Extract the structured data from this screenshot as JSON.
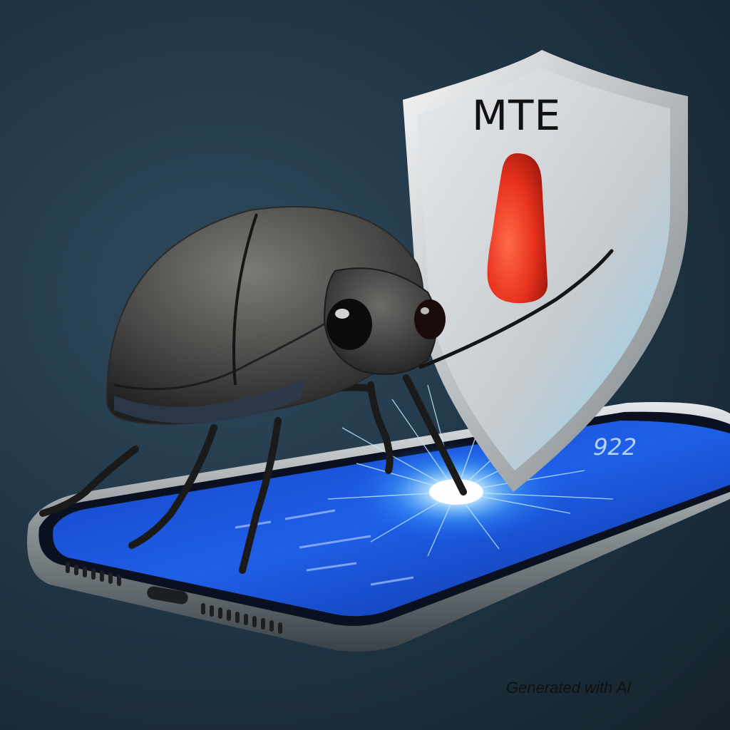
{
  "shield": {
    "label": "MTE"
  },
  "phone": {
    "clock": "922"
  },
  "caption": "Generated with AI",
  "colors": {
    "background": "#1c2f3d",
    "shield_silver": "#c9ced2",
    "drop_red": "#e8321e",
    "screen_blue": "#1a4fd8",
    "spark": "#bfe8ff"
  },
  "icons": [
    "beetle-icon",
    "shield-icon",
    "smartphone-icon",
    "spark-icon"
  ]
}
